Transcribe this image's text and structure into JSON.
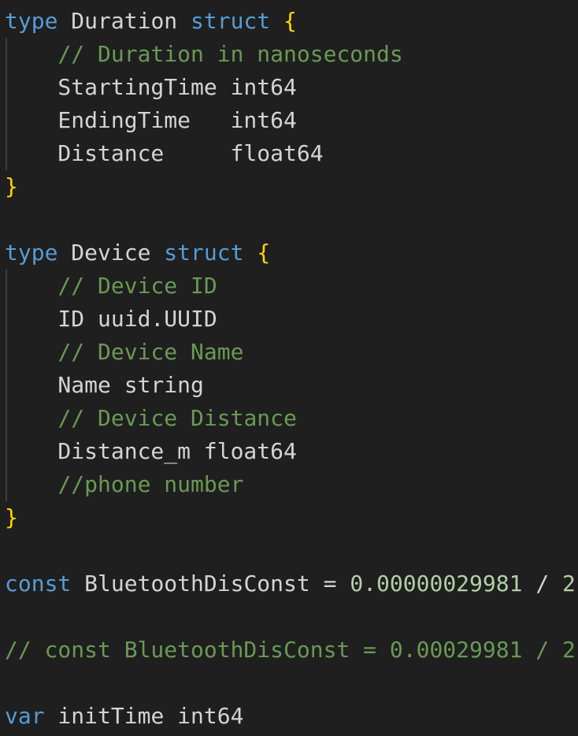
{
  "colors": {
    "background": "#1f1f1f",
    "keyword": "#569cd6",
    "identifier": "#d4d4d4",
    "brace": "#ffd700",
    "comment": "#6a9955",
    "number": "#b5cea8",
    "indent_guide": "#3c3c3c"
  },
  "lines": [
    {
      "tokens": [
        [
          "kw",
          "type"
        ],
        [
          "type",
          " Duration "
        ],
        [
          "kw",
          "struct"
        ],
        [
          "type",
          " "
        ],
        [
          "brace",
          "{"
        ]
      ]
    },
    {
      "tokens": [
        [
          "type",
          "    "
        ],
        [
          "cm",
          "// Duration in nanoseconds"
        ]
      ]
    },
    {
      "tokens": [
        [
          "type",
          "    StartingTime int64"
        ]
      ]
    },
    {
      "tokens": [
        [
          "type",
          "    EndingTime   int64"
        ]
      ]
    },
    {
      "tokens": [
        [
          "type",
          "    Distance     float64"
        ]
      ]
    },
    {
      "tokens": [
        [
          "brace",
          "}"
        ]
      ]
    },
    {
      "tokens": []
    },
    {
      "tokens": [
        [
          "kw",
          "type"
        ],
        [
          "type",
          " Device "
        ],
        [
          "kw",
          "struct"
        ],
        [
          "type",
          " "
        ],
        [
          "brace",
          "{"
        ]
      ]
    },
    {
      "tokens": [
        [
          "type",
          "    "
        ],
        [
          "cm",
          "// Device ID"
        ]
      ]
    },
    {
      "tokens": [
        [
          "type",
          "    ID uuid.UUID"
        ]
      ]
    },
    {
      "tokens": [
        [
          "type",
          "    "
        ],
        [
          "cm",
          "// Device Name"
        ]
      ]
    },
    {
      "tokens": [
        [
          "type",
          "    Name string"
        ]
      ]
    },
    {
      "tokens": [
        [
          "type",
          "    "
        ],
        [
          "cm",
          "// Device Distance"
        ]
      ]
    },
    {
      "tokens": [
        [
          "type",
          "    Distance_m float64"
        ]
      ]
    },
    {
      "tokens": [
        [
          "type",
          "    "
        ],
        [
          "cm",
          "//phone number"
        ]
      ]
    },
    {
      "tokens": [
        [
          "brace",
          "}"
        ]
      ]
    },
    {
      "tokens": []
    },
    {
      "tokens": [
        [
          "kw",
          "const"
        ],
        [
          "type",
          " BluetoothDisConst "
        ],
        [
          "op",
          "="
        ],
        [
          "type",
          " "
        ],
        [
          "num",
          "0.00000029981"
        ],
        [
          "op",
          " / "
        ],
        [
          "num",
          "2"
        ]
      ]
    },
    {
      "tokens": []
    },
    {
      "tokens": [
        [
          "cm",
          "// const BluetoothDisConst = 0.00029981 / 2"
        ]
      ]
    },
    {
      "tokens": []
    },
    {
      "tokens": [
        [
          "kw",
          "var"
        ],
        [
          "type",
          " initTime int64"
        ]
      ]
    }
  ]
}
